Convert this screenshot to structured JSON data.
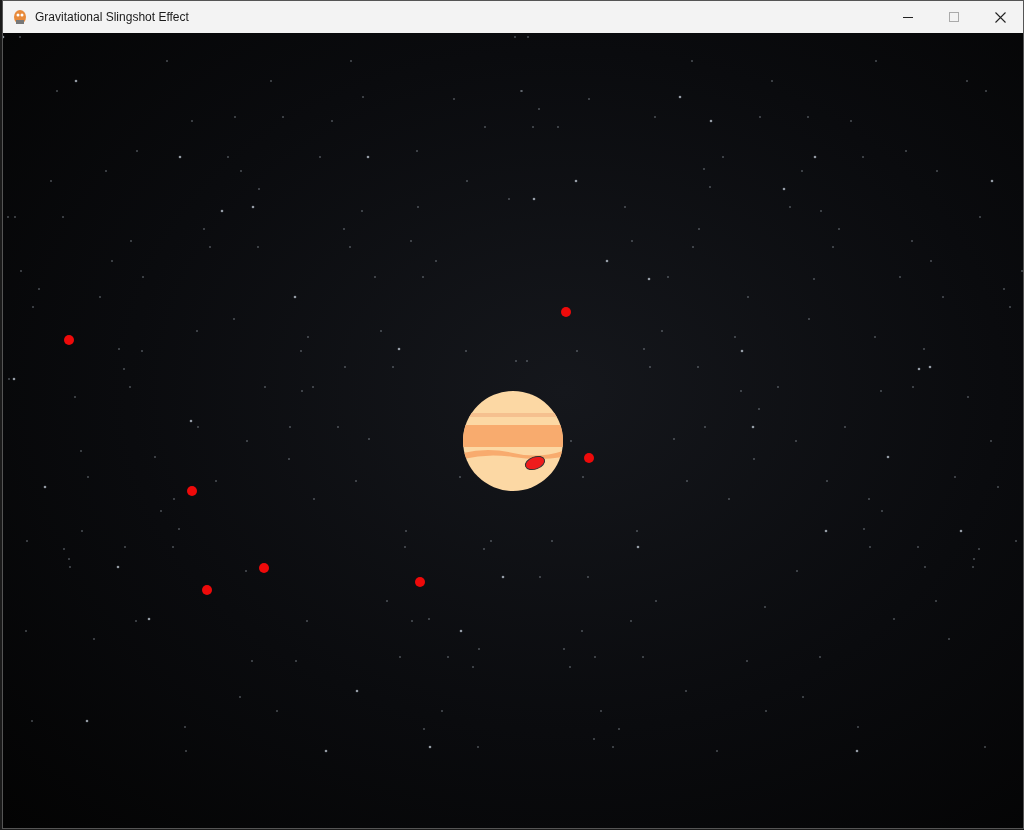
{
  "window": {
    "title": "Gravitational Slingshot Effect"
  }
}
